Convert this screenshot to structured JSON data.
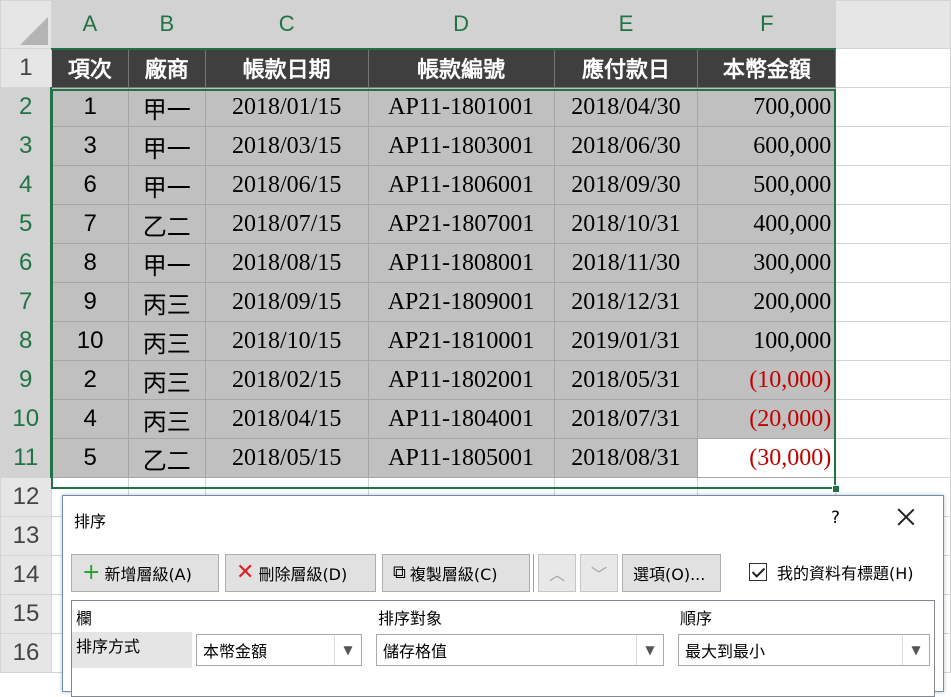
{
  "columns": [
    "A",
    "B",
    "C",
    "D",
    "E",
    "F"
  ],
  "row_numbers": [
    "1",
    "2",
    "3",
    "4",
    "5",
    "6",
    "7",
    "8",
    "9",
    "10",
    "11",
    "12",
    "13",
    "14",
    "15",
    "16"
  ],
  "header": [
    "項次",
    "廠商",
    "帳款日期",
    "帳款編號",
    "應付款日",
    "本幣金額"
  ],
  "rows": [
    {
      "item": "1",
      "vendor": "甲一",
      "date": "2018/01/15",
      "no": "AP11-1801001",
      "due": "2018/04/30",
      "amount": "700,000"
    },
    {
      "item": "3",
      "vendor": "甲一",
      "date": "2018/03/15",
      "no": "AP11-1803001",
      "due": "2018/06/30",
      "amount": "600,000"
    },
    {
      "item": "6",
      "vendor": "甲一",
      "date": "2018/06/15",
      "no": "AP11-1806001",
      "due": "2018/09/30",
      "amount": "500,000"
    },
    {
      "item": "7",
      "vendor": "乙二",
      "date": "2018/07/15",
      "no": "AP21-1807001",
      "due": "2018/10/31",
      "amount": "400,000"
    },
    {
      "item": "8",
      "vendor": "甲一",
      "date": "2018/08/15",
      "no": "AP11-1808001",
      "due": "2018/11/30",
      "amount": "300,000"
    },
    {
      "item": "9",
      "vendor": "丙三",
      "date": "2018/09/15",
      "no": "AP21-1809001",
      "due": "2018/12/31",
      "amount": "200,000"
    },
    {
      "item": "10",
      "vendor": "丙三",
      "date": "2018/10/15",
      "no": "AP21-1810001",
      "due": "2019/01/31",
      "amount": "100,000"
    },
    {
      "item": "2",
      "vendor": "丙三",
      "date": "2018/02/15",
      "no": "AP11-1802001",
      "due": "2018/05/31",
      "amount": "(10,000)"
    },
    {
      "item": "4",
      "vendor": "丙三",
      "date": "2018/04/15",
      "no": "AP11-1804001",
      "due": "2018/07/31",
      "amount": "(20,000)"
    },
    {
      "item": "5",
      "vendor": "乙二",
      "date": "2018/05/15",
      "no": "AP11-1805001",
      "due": "2018/08/31",
      "amount": "(30,000)"
    }
  ],
  "colors": {
    "accent": "#217346",
    "negative": "#c00000",
    "header_fill": "#3f3f3f",
    "data_fill": "#c0c0c0"
  },
  "dialog": {
    "title": "排序",
    "help": "?",
    "add_level": "新增層級(A)",
    "add_level_key": "A",
    "delete_level": "刪除層級(D)",
    "copy_level": "複製層級(C)",
    "options": "選項(O)...",
    "has_headers": "我的資料有標題(H)",
    "col_header": "欄",
    "sort_on_header": "排序對象",
    "order_header": "順序",
    "sort_by_label": "排序方式",
    "sort_column": "本幣金額",
    "sort_on": "儲存格值",
    "order": "最大到最小"
  }
}
